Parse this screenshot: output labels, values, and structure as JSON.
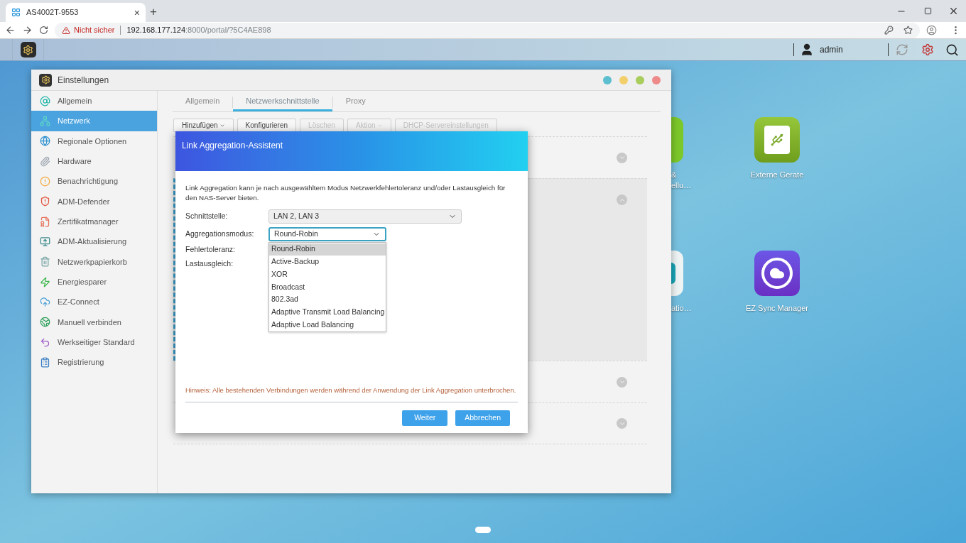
{
  "browser": {
    "tab": {
      "title": "AS4002T-9553",
      "close": "×"
    },
    "new_tab": "+",
    "address": {
      "warning": "Nicht sicher",
      "host": "192.168.177.124",
      "rest": ":8000/portal/?5C4AE898"
    }
  },
  "taskbar": {
    "user": "admin"
  },
  "window": {
    "title": "Einstellungen",
    "controls": [
      {
        "color": "#5bbfcf"
      },
      {
        "color": "#f2cf6a"
      },
      {
        "color": "#a8cd5c"
      },
      {
        "color": "#ee8a8a"
      }
    ],
    "sidebar": [
      {
        "label": "Allgemein",
        "selected": false
      },
      {
        "label": "Netzwerk",
        "selected": true
      },
      {
        "label": "Regionale Optionen",
        "selected": false
      },
      {
        "label": "Hardware",
        "selected": false
      },
      {
        "label": "Benachrichtigung",
        "selected": false
      },
      {
        "label": "ADM-Defender",
        "selected": false
      },
      {
        "label": "Zertifikatmanager",
        "selected": false
      },
      {
        "label": "ADM-Aktualisierung",
        "selected": false
      },
      {
        "label": "Netzwerkpapierkorb",
        "selected": false
      },
      {
        "label": "Energiesparer",
        "selected": false
      },
      {
        "label": "EZ-Connect",
        "selected": false
      },
      {
        "label": "Manuell verbinden",
        "selected": false
      },
      {
        "label": "Werkseitiger Standard",
        "selected": false
      },
      {
        "label": "Registrierung",
        "selected": false
      }
    ],
    "tabs": [
      {
        "label": "Allgemein",
        "selected": false
      },
      {
        "label": "Netzwerkschnittstelle",
        "selected": true
      },
      {
        "label": "Proxy",
        "selected": false
      }
    ],
    "toolbar": [
      {
        "label": "Hinzufügen",
        "dropdown": true,
        "disabled": false
      },
      {
        "label": "Konfigurieren",
        "dropdown": false,
        "disabled": false
      },
      {
        "label": "Löschen",
        "dropdown": false,
        "disabled": true
      },
      {
        "label": "Aktion",
        "dropdown": true,
        "disabled": true
      },
      {
        "label": "DHCP-Servereinstellungen",
        "dropdown": false,
        "disabled": true
      }
    ],
    "rows": [
      {
        "expanded": false
      },
      {
        "expanded": true
      },
      {
        "expanded": false
      },
      {
        "expanded": false
      }
    ]
  },
  "dialog": {
    "title": "Link Aggregation-Assistent",
    "description": "Link Aggregation kann je nach ausgewähltem Modus Netzwerkfehlertoleranz und/oder Lastausgleich für den NAS-Server bieten.",
    "fields": [
      {
        "label": "Schnittstelle:",
        "kind": "select",
        "value": "LAN 2, LAN 3",
        "focused": false
      },
      {
        "label": "Aggregationsmodus:",
        "kind": "select",
        "value": "Round-Robin",
        "focused": true,
        "options": [
          {
            "label": "Round-Robin",
            "selected": true
          },
          {
            "label": "Active-Backup",
            "selected": false
          },
          {
            "label": "XOR",
            "selected": false
          },
          {
            "label": "Broadcast",
            "selected": false
          },
          {
            "label": "802.3ad",
            "selected": false
          },
          {
            "label": "Adaptive Transmit Load Balancing",
            "selected": false
          },
          {
            "label": "Adaptive Load Balancing",
            "selected": false
          }
        ]
      },
      {
        "label": "Fehlertoleranz:",
        "kind": "text"
      },
      {
        "label": "Lastausgleich:",
        "kind": "text"
      }
    ],
    "note": "Hinweis: Alle bestehenden Verbindungen werden während der Anwendung der Link Aggregation unterbrochen.",
    "buttons": [
      "Weiter",
      "Abbrechen"
    ]
  },
  "desktop": {
    "icons": [
      {
        "kind": "greentile",
        "label_lines": [
          "&",
          "ellu…"
        ]
      },
      {
        "kind": "whitetile",
        "label_lines": [
          "atio…"
        ]
      },
      {
        "kind": "usb",
        "label_lines": [
          "Externe Gerate"
        ]
      },
      {
        "kind": "sync",
        "label_lines": [
          "EZ Sync Manager"
        ]
      }
    ]
  }
}
